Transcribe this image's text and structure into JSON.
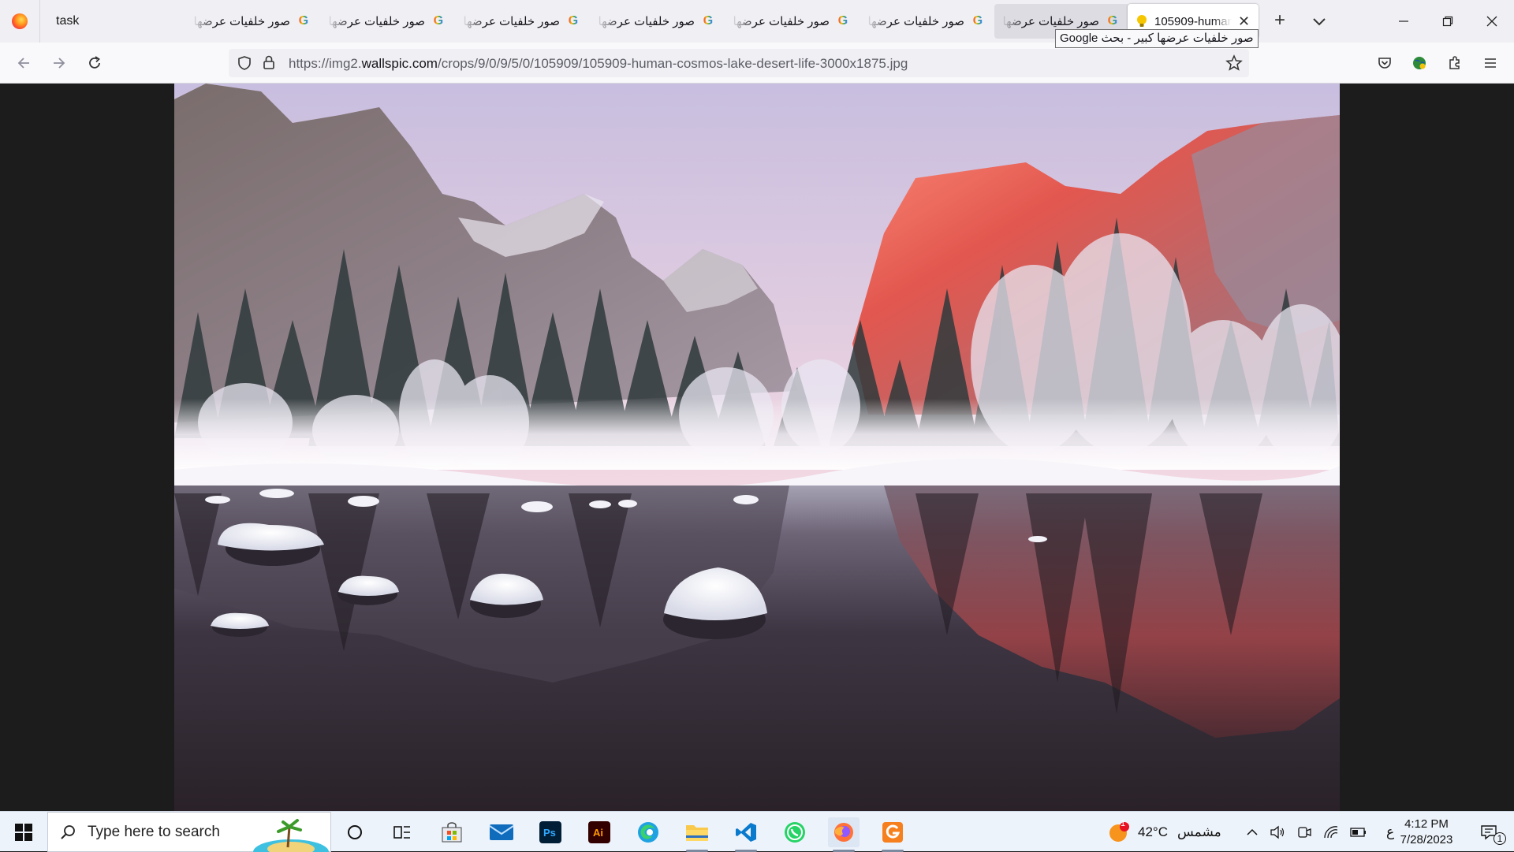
{
  "browser": {
    "workspace_label": "task",
    "tabs": [
      {
        "label": "صور خلفيات عرضها كبير - بحث Google",
        "icon": "google-icon"
      },
      {
        "label": "صور خلفيات عرضها كبير - بحث Google",
        "icon": "google-icon"
      },
      {
        "label": "صور خلفيات عرضها كبير - بحث Google",
        "icon": "google-icon"
      },
      {
        "label": "صور خلفيات عرضها كبير - بحث Google",
        "icon": "google-icon"
      },
      {
        "label": "صور خلفيات عرضها كبير - بحث Google",
        "icon": "google-icon"
      },
      {
        "label": "صور خلفيات عرضها كبير - بحث Google",
        "icon": "google-icon"
      },
      {
        "label": "صور خلفيات عرضها كبير - بحث Google",
        "icon": "google-icon"
      }
    ],
    "active_tab": {
      "label": "105909-human-cosmos-lake-desert-life-3000x1875.jpg",
      "icon": "bulb-icon"
    },
    "tooltip": "صور خلفيات عرضها كبير - بحث Google",
    "url": {
      "prefix": "https://img2.",
      "domain": "wallspic.com",
      "path": "/crops/9/0/9/5/0/105909/105909-human-cosmos-lake-desert-life-3000x1875.jpg"
    }
  },
  "taskbar": {
    "search_placeholder": "Type here to search",
    "weather": {
      "temp": "42°C",
      "condition": "مشمس",
      "badge": "1"
    },
    "lang": "ع",
    "time": "4:12 PM",
    "date": "7/28/2023",
    "notification_count": "1",
    "apps": [
      "windows-start",
      "cortana",
      "task-view",
      "microsoft-store",
      "mail",
      "photoshop",
      "illustrator",
      "edge",
      "file-explorer",
      "vscode",
      "whatsapp",
      "firefox",
      "app-orange"
    ]
  },
  "colors": {
    "accent": "#0060df",
    "tab_bg": "#f0f0f4",
    "taskbar_bg": "#edf3fb"
  }
}
